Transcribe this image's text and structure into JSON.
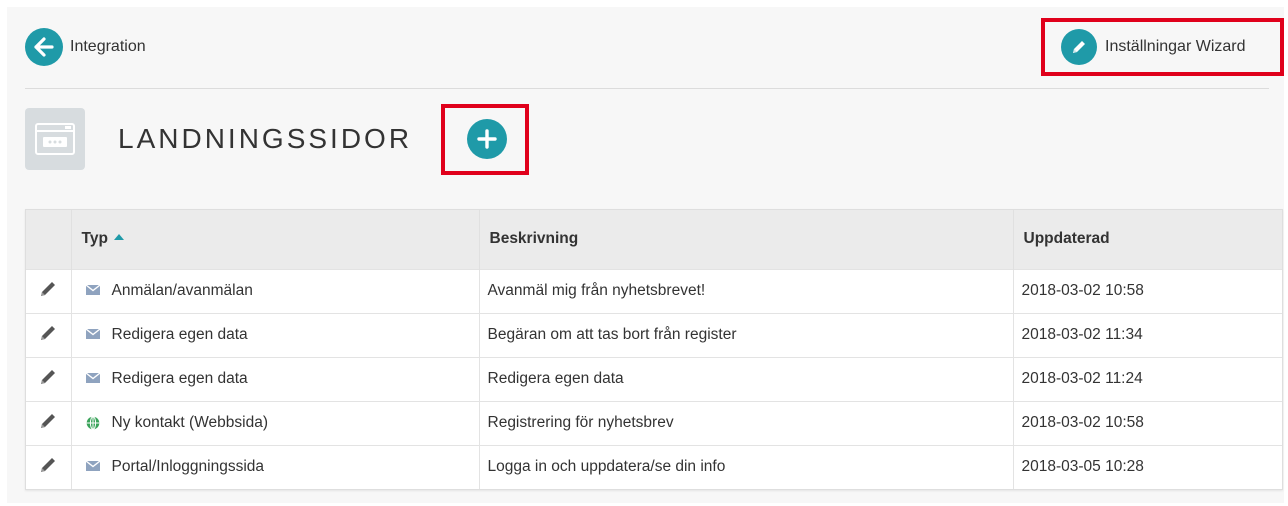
{
  "header": {
    "back_label": "Integration",
    "wizard_label": "Inställningar Wizard"
  },
  "page": {
    "title": "LANDNINGSSIDOR"
  },
  "table": {
    "columns": [
      "Typ",
      "Beskrivning",
      "Uppdaterad"
    ],
    "rows": [
      {
        "icon": "envelope-icon",
        "typ": "Anmälan/avanmälan",
        "beskrivning": "Avanmäl mig från nyhetsbrevet!",
        "uppdaterad": "2018-03-02 10:58"
      },
      {
        "icon": "envelope-icon",
        "typ": "Redigera egen data",
        "beskrivning": "Begäran om att tas bort från register",
        "uppdaterad": "2018-03-02 11:34"
      },
      {
        "icon": "envelope-icon",
        "typ": "Redigera egen data",
        "beskrivning": "Redigera egen data",
        "uppdaterad": "2018-03-02 11:24"
      },
      {
        "icon": "globe-icon",
        "typ": "Ny kontakt (Webbsida)",
        "beskrivning": "Registrering för nyhetsbrev",
        "uppdaterad": "2018-03-02 10:58"
      },
      {
        "icon": "envelope-icon",
        "typ": "Portal/Inloggningssida",
        "beskrivning": "Logga in och uppdatera/se din info",
        "uppdaterad": "2018-03-05 10:28"
      }
    ]
  },
  "colors": {
    "accent": "#1f9aa8",
    "highlight": "#e0001b",
    "envelope": "#8fa3bf",
    "globe": "#3aa35a"
  }
}
